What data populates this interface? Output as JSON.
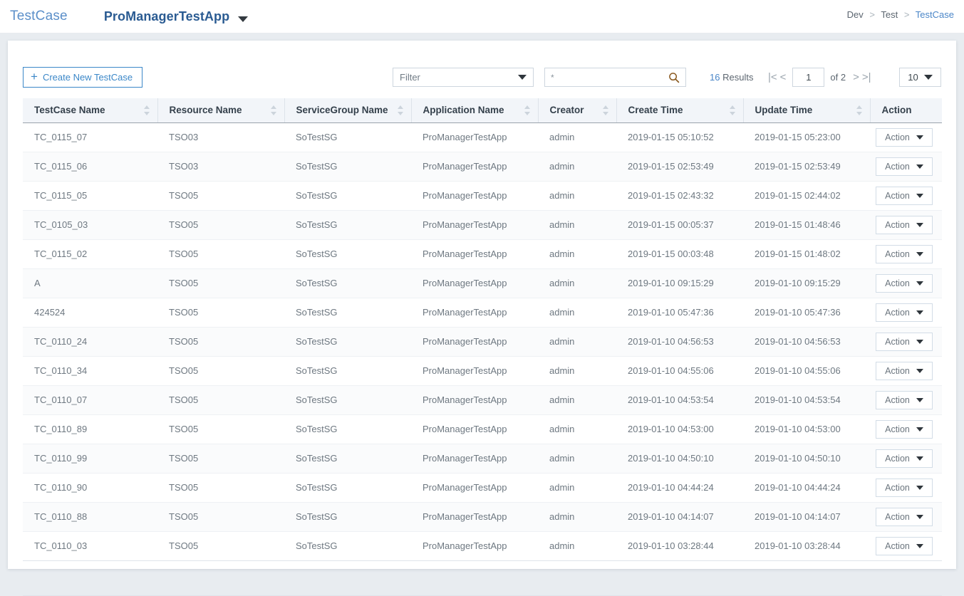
{
  "topbar": {
    "title": "TestCase",
    "app_name": "ProManagerTestApp",
    "app_caret_icon": "chevron-down-icon",
    "breadcrumb": {
      "items": [
        "Dev",
        "Test",
        "TestCase"
      ],
      "separator": ">"
    }
  },
  "toolbar": {
    "create_label": "Create New TestCase",
    "plus_icon": "plus-icon",
    "filter_label": "Filter",
    "filter_caret_icon": "chevron-down-icon",
    "search_value": "*",
    "search_placeholder": "",
    "search_icon": "search-icon",
    "results_count": "16",
    "results_label": "Results",
    "pager": {
      "first_icon": "|<",
      "prev_icon": "<",
      "next_icon": ">",
      "last_icon": ">|",
      "current_page": "1",
      "of_label": "of 2"
    },
    "page_size": "10",
    "page_size_caret_icon": "chevron-down-icon"
  },
  "table": {
    "columns": [
      {
        "label": "TestCase  Name",
        "sortable": true
      },
      {
        "label": "Resource  Name",
        "sortable": true
      },
      {
        "label": "ServiceGroup  Name",
        "sortable": true
      },
      {
        "label": "Application  Name",
        "sortable": true
      },
      {
        "label": "Creator",
        "sortable": true
      },
      {
        "label": "Create  Time",
        "sortable": true
      },
      {
        "label": "Update  Time",
        "sortable": true
      },
      {
        "label": "Action",
        "sortable": false
      }
    ],
    "action_label": "Action",
    "action_caret_icon": "chevron-down-icon",
    "rows": [
      {
        "testcase_name": "TC_0115_07",
        "resource_name": "TSO03",
        "servicegroup_name": "SoTestSG",
        "application_name": "ProManagerTestApp",
        "creator": "admin",
        "create_time": "2019-01-15 05:10:52",
        "update_time": "2019-01-15 05:23:00"
      },
      {
        "testcase_name": "TC_0115_06",
        "resource_name": "TSO03",
        "servicegroup_name": "SoTestSG",
        "application_name": "ProManagerTestApp",
        "creator": "admin",
        "create_time": "2019-01-15 02:53:49",
        "update_time": "2019-01-15 02:53:49"
      },
      {
        "testcase_name": "TC_0115_05",
        "resource_name": "TSO05",
        "servicegroup_name": "SoTestSG",
        "application_name": "ProManagerTestApp",
        "creator": "admin",
        "create_time": "2019-01-15 02:43:32",
        "update_time": "2019-01-15 02:44:02"
      },
      {
        "testcase_name": "TC_0105_03",
        "resource_name": "TSO05",
        "servicegroup_name": "SoTestSG",
        "application_name": "ProManagerTestApp",
        "creator": "admin",
        "create_time": "2019-01-15 00:05:37",
        "update_time": "2019-01-15 01:48:46"
      },
      {
        "testcase_name": "TC_0115_02",
        "resource_name": "TSO05",
        "servicegroup_name": "SoTestSG",
        "application_name": "ProManagerTestApp",
        "creator": "admin",
        "create_time": "2019-01-15 00:03:48",
        "update_time": "2019-01-15 01:48:02"
      },
      {
        "testcase_name": "A",
        "resource_name": "TSO05",
        "servicegroup_name": "SoTestSG",
        "application_name": "ProManagerTestApp",
        "creator": "admin",
        "create_time": "2019-01-10 09:15:29",
        "update_time": "2019-01-10 09:15:29"
      },
      {
        "testcase_name": "424524",
        "resource_name": "TSO05",
        "servicegroup_name": "SoTestSG",
        "application_name": "ProManagerTestApp",
        "creator": "admin",
        "create_time": "2019-01-10 05:47:36",
        "update_time": "2019-01-10 05:47:36"
      },
      {
        "testcase_name": "TC_0110_24",
        "resource_name": "TSO05",
        "servicegroup_name": "SoTestSG",
        "application_name": "ProManagerTestApp",
        "creator": "admin",
        "create_time": "2019-01-10 04:56:53",
        "update_time": "2019-01-10 04:56:53"
      },
      {
        "testcase_name": "TC_0110_34",
        "resource_name": "TSO05",
        "servicegroup_name": "SoTestSG",
        "application_name": "ProManagerTestApp",
        "creator": "admin",
        "create_time": "2019-01-10 04:55:06",
        "update_time": "2019-01-10 04:55:06"
      },
      {
        "testcase_name": "TC_0110_07",
        "resource_name": "TSO05",
        "servicegroup_name": "SoTestSG",
        "application_name": "ProManagerTestApp",
        "creator": "admin",
        "create_time": "2019-01-10 04:53:54",
        "update_time": "2019-01-10 04:53:54"
      },
      {
        "testcase_name": "TC_0110_89",
        "resource_name": "TSO05",
        "servicegroup_name": "SoTestSG",
        "application_name": "ProManagerTestApp",
        "creator": "admin",
        "create_time": "2019-01-10 04:53:00",
        "update_time": "2019-01-10 04:53:00"
      },
      {
        "testcase_name": "TC_0110_99",
        "resource_name": "TSO05",
        "servicegroup_name": "SoTestSG",
        "application_name": "ProManagerTestApp",
        "creator": "admin",
        "create_time": "2019-01-10 04:50:10",
        "update_time": "2019-01-10 04:50:10"
      },
      {
        "testcase_name": "TC_0110_90",
        "resource_name": "TSO05",
        "servicegroup_name": "SoTestSG",
        "application_name": "ProManagerTestApp",
        "creator": "admin",
        "create_time": "2019-01-10 04:44:24",
        "update_time": "2019-01-10 04:44:24"
      },
      {
        "testcase_name": "TC_0110_88",
        "resource_name": "TSO05",
        "servicegroup_name": "SoTestSG",
        "application_name": "ProManagerTestApp",
        "creator": "admin",
        "create_time": "2019-01-10 04:14:07",
        "update_time": "2019-01-10 04:14:07"
      },
      {
        "testcase_name": "TC_0110_03",
        "resource_name": "TSO05",
        "servicegroup_name": "SoTestSG",
        "application_name": "ProManagerTestApp",
        "creator": "admin",
        "create_time": "2019-01-10 03:28:44",
        "update_time": "2019-01-10 03:28:44"
      }
    ]
  },
  "colors": {
    "accent_blue": "#3b87c8",
    "title_blue": "#5b8fc9",
    "app_blue": "#2a5b92",
    "page_bg": "#e8ecf0",
    "header_bg": "#f2f5f9",
    "search_icon": "#8a5a20"
  }
}
